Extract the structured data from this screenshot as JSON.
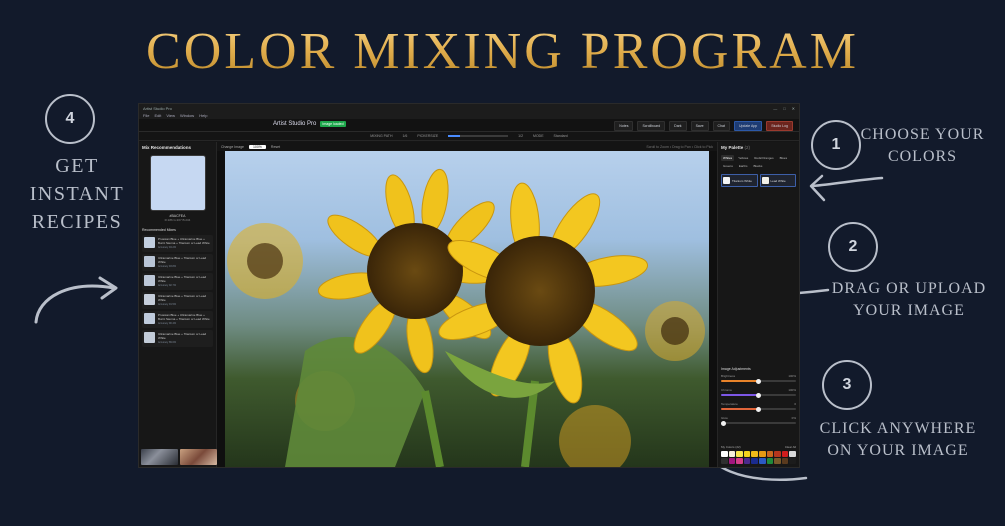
{
  "poster": {
    "title": "COLOR MIXING PROGRAM"
  },
  "steps": [
    {
      "number": "1",
      "text_lines": [
        "CHOOSE YOUR",
        "COLORS"
      ]
    },
    {
      "number": "2",
      "text_lines": [
        "DRAG OR UPLOAD",
        "YOUR IMAGE"
      ]
    },
    {
      "number": "3",
      "text_lines": [
        "CLICK ANYWHERE",
        "ON YOUR IMAGE"
      ]
    },
    {
      "number": "4",
      "text_lines": [
        "GET",
        "INSTANT",
        "RECIPES"
      ]
    }
  ],
  "app": {
    "window_title": "Artist Studio Pro",
    "window_controls": [
      "—",
      "□",
      "✕"
    ],
    "menu": [
      "File",
      "Edit",
      "View",
      "Window",
      "Help"
    ],
    "brand": "Artist Studio Pro",
    "badge": "Image loaded",
    "toolbar_buttons": [
      "Notes",
      "Scrollboard",
      "Dark",
      "Save",
      "Chat",
      "Update App",
      "Studio Log"
    ],
    "subbar": {
      "mix_label": "MIXING PATH",
      "mix_value": "1/6",
      "size_label": "PICKERSIZE",
      "size_value": "1/2",
      "mode_label": "MODE",
      "mode_value": "Standard"
    },
    "left": {
      "header": "Mix Recommendations",
      "swatch_color": "#c6d8f2",
      "hex": "#BACFEA",
      "sub": "R:186 G:207 B:234",
      "recommended_header": "Recommended Mixes",
      "recipes": [
        {
          "name": "Prussian Blue + Ultramarine Blue + Burnt Sienna + Titanium or Lead White",
          "detail": "Accuracy 94.2%",
          "color": "#c2cfe0"
        },
        {
          "name": "Ultramarine Blue + Titanium or Lead White",
          "detail": "Accuracy 93.8%",
          "color": "#b9c5d6"
        },
        {
          "name": "Ultramarine Blue + Titanium or Lead White",
          "detail": "Accuracy 92.7%",
          "color": "#bdc8d8"
        },
        {
          "name": "Ultramarine Blue + Titanium or Lead White",
          "detail": "Accuracy 91.5%",
          "color": "#c6cedb"
        },
        {
          "name": "Prussian Blue + Ultramarine Blue + Burnt Sienna + Titanium or Lead White",
          "detail": "Accuracy 90.4%",
          "color": "#bfcbdc"
        },
        {
          "name": "Ultramarine Blue + Titanium or Lead White",
          "detail": "Accuracy 89.6%",
          "color": "#c3ccd8"
        }
      ]
    },
    "center": {
      "change_image": "Change Image",
      "zoom": "100%",
      "reset": "Reset",
      "hint": "Scroll to Zoom • Drag to Pan • Click to Pick"
    },
    "right": {
      "header": "My Palette",
      "header_count": "(2)",
      "tabs": [
        "Whites",
        "Yellows",
        "Reds/Oranges",
        "Blues",
        "Greens",
        "Earths",
        "Blacks"
      ],
      "palette": [
        {
          "name": "Titanium White",
          "color": "#f4f5f5"
        },
        {
          "name": "Lead White",
          "color": "#f2f0e8"
        }
      ],
      "adjust_header": "Image Adjustments",
      "adjustments": [
        {
          "label": "Brightness",
          "value": "100%",
          "level": 0.5,
          "color": "#e8832a"
        },
        {
          "label": "Chroma",
          "value": "100%",
          "level": 0.5,
          "color": "#7d57e6"
        },
        {
          "label": "Temperature",
          "value": "0",
          "level": 0.5,
          "color": "#e0653a"
        },
        {
          "label": "Glow",
          "value": "0%",
          "level": 0.03,
          "color": "#888888"
        }
      ],
      "mycolors_header": "My Colors (22)",
      "mycolors_action": "Clear All",
      "mycolors": [
        "#ffffff",
        "#f5f0d9",
        "#f7e64b",
        "#f4d21b",
        "#f0b91a",
        "#e59a13",
        "#c9671e",
        "#b7361d",
        "#d11d1d",
        "#d8d8d8",
        "#2f2f2f",
        "#a3167f",
        "#d43e8a",
        "#4a2a8d",
        "#1a2b8f",
        "#2b59c3",
        "#1f8a3a",
        "#7a5a2a",
        "#5a3a1e",
        "#1c1c1c"
      ]
    }
  }
}
